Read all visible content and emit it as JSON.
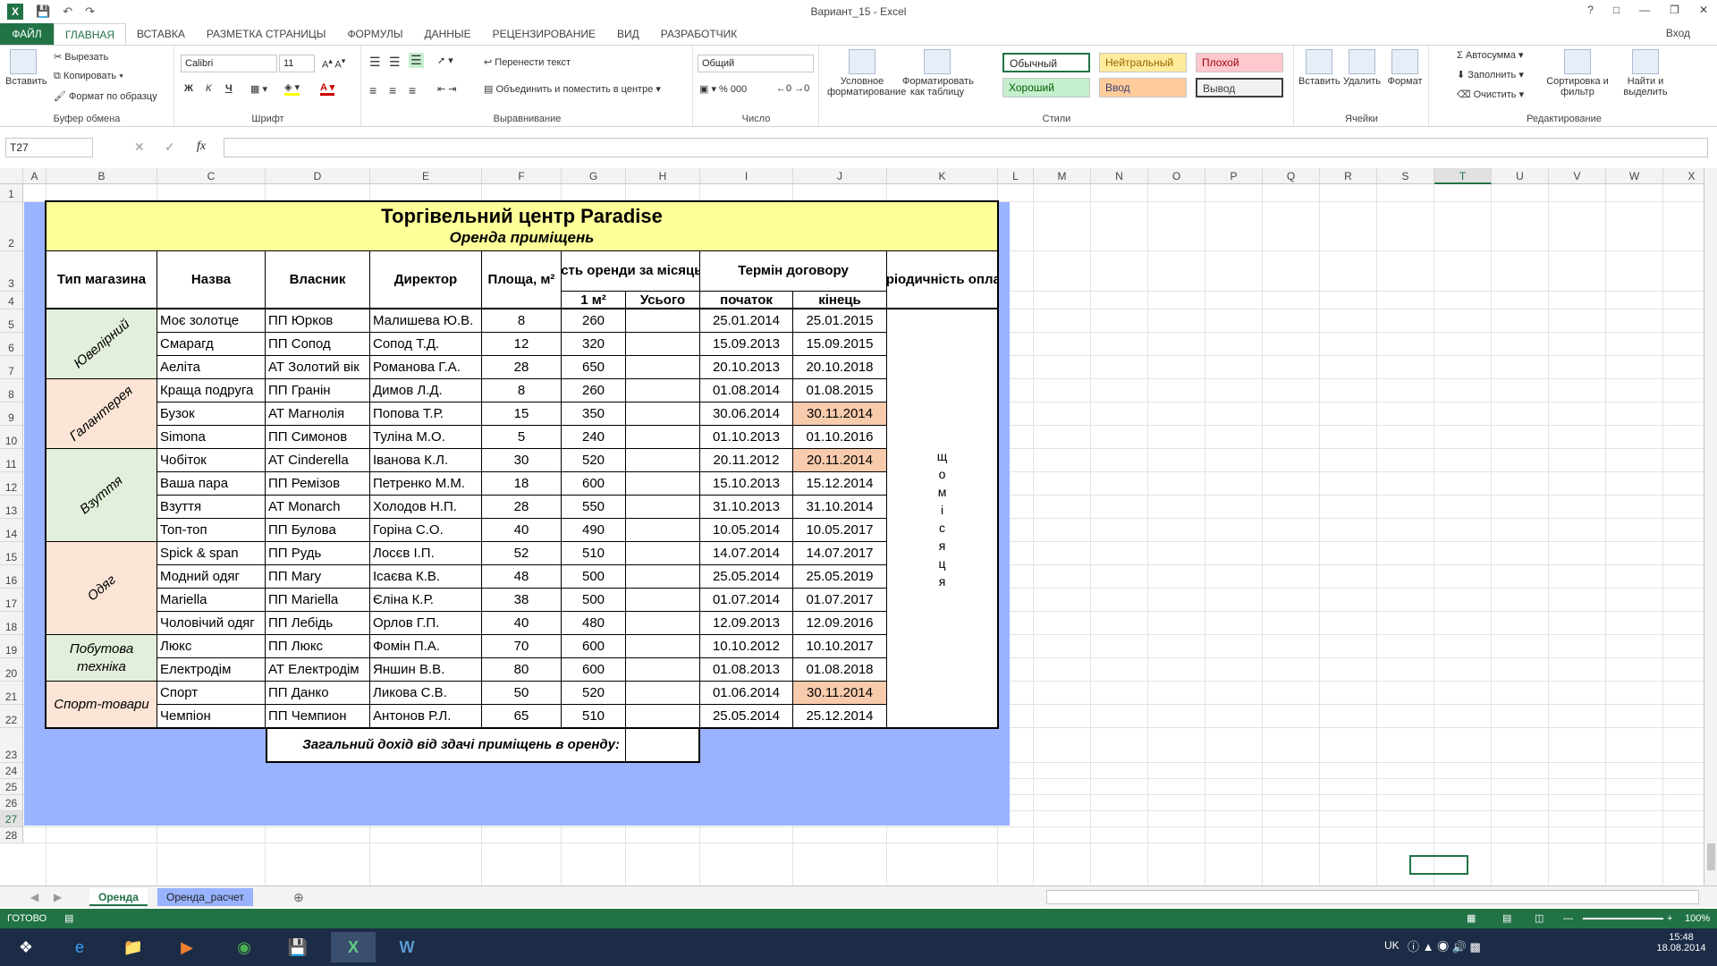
{
  "window": {
    "title": "Вариант_15 - Excel",
    "login": "Вход",
    "help": "?"
  },
  "tabs": [
    "ФАЙЛ",
    "ГЛАВНАЯ",
    "ВСТАВКА",
    "РАЗМЕТКА СТРАНИЦЫ",
    "ФОРМУЛЫ",
    "ДАННЫЕ",
    "РЕЦЕНЗИРОВАНИЕ",
    "ВИД",
    "РАЗРАБОТЧИК"
  ],
  "ribbon": {
    "clipboard": {
      "paste": "Вставить",
      "cut": "Вырезать",
      "copy": "Копировать",
      "format_painter": "Формат по образцу",
      "name": "Буфер обмена"
    },
    "font": {
      "family": "Calibri",
      "size": "11",
      "bold": "Ж",
      "italic": "К",
      "underline": "Ч",
      "name": "Шрифт"
    },
    "alignment": {
      "wrap": "Перенести текст",
      "merge": "Объединить и поместить в центре",
      "name": "Выравнивание"
    },
    "number": {
      "format": "Общий",
      "name": "Число"
    },
    "styles": {
      "conditional": "Условное форматирование",
      "as_table": "Форматировать как таблицу",
      "normal": "Обычный",
      "neutral": "Нейтральный",
      "bad": "Плохой",
      "good": "Хороший",
      "input": "Ввод",
      "output": "Вывод",
      "name": "Стили"
    },
    "cells": {
      "insert": "Вставить",
      "delete": "Удалить",
      "format": "Формат",
      "name": "Ячейки"
    },
    "editing": {
      "autosum": "Автосумма",
      "fill": "Заполнить",
      "clear": "Очистить",
      "sort": "Сортировка и фильтр",
      "find": "Найти и выделить",
      "name": "Редактирование"
    }
  },
  "formula_bar": {
    "cell_ref": "T27",
    "fx": "fx",
    "content": ""
  },
  "columns": [
    "A",
    "B",
    "C",
    "D",
    "E",
    "F",
    "G",
    "H",
    "I",
    "J",
    "K",
    "L",
    "M",
    "N",
    "O",
    "P",
    "Q",
    "R",
    "S",
    "T",
    "U",
    "V",
    "W",
    "X"
  ],
  "rows": [
    "1",
    "2",
    "3",
    "4",
    "5",
    "6",
    "7",
    "8",
    "9",
    "10",
    "11",
    "12",
    "13",
    "14",
    "15",
    "16",
    "17",
    "18",
    "19",
    "20",
    "21",
    "22",
    "23",
    "24",
    "25",
    "26",
    "27",
    "28"
  ],
  "table": {
    "title": "Торгівельний центр Paradise",
    "subtitle": "Оренда приміщень",
    "headers": {
      "type": "Тип магазина",
      "name": "Назва",
      "owner": "Власник",
      "director": "Директор",
      "area": "Площа, м²",
      "cost": "Вартість оренди за місяць, грн.",
      "cost_per_m2": "1 м²",
      "cost_total": "Усього",
      "term": "Термін договору",
      "start": "початок",
      "end": "кінець",
      "period": "Періодичність оплати"
    },
    "types": [
      "Ювелірний",
      "Галантерея",
      "Взуття",
      "Одяг",
      "Побутова техніка",
      "Спорт-товари"
    ],
    "period_value": [
      "щ",
      "о",
      "м",
      "і",
      "с",
      "я",
      "ц",
      "я"
    ],
    "rows": [
      [
        "Моє золотце",
        "ПП Юрков",
        "Малишева Ю.В.",
        "8",
        "260",
        "",
        "25.01.2014",
        "25.01.2015"
      ],
      [
        "Смарагд",
        "ПП Сопод",
        "Сопод Т.Д.",
        "12",
        "320",
        "",
        "15.09.2013",
        "15.09.2015"
      ],
      [
        "Аеліта",
        "АТ Золотий вік",
        "Романова Г.А.",
        "28",
        "650",
        "",
        "20.10.2013",
        "20.10.2018"
      ],
      [
        "Краща подруга",
        "ПП Гранін",
        "Димов Л.Д.",
        "8",
        "260",
        "",
        "01.08.2014",
        "01.08.2015"
      ],
      [
        "Бузок",
        "АТ Магнолія",
        "Попова Т.Р.",
        "15",
        "350",
        "",
        "30.06.2014",
        "30.11.2014"
      ],
      [
        "Simona",
        "ПП Симонов",
        "Туліна М.О.",
        "5",
        "240",
        "",
        "01.10.2013",
        "01.10.2016"
      ],
      [
        "Чобіток",
        "АТ Cinderella",
        "Іванова К.Л.",
        "30",
        "520",
        "",
        "20.11.2012",
        "20.11.2014"
      ],
      [
        "Ваша пара",
        "ПП Ремізов",
        "Петренко М.М.",
        "18",
        "600",
        "",
        "15.10.2013",
        "15.12.2014"
      ],
      [
        "Взуття",
        "АТ Monarch",
        "Холодов Н.П.",
        "28",
        "550",
        "",
        "31.10.2013",
        "31.10.2014"
      ],
      [
        "Топ-топ",
        "ПП Булова",
        "Горіна С.О.",
        "40",
        "490",
        "",
        "10.05.2014",
        "10.05.2017"
      ],
      [
        "Spick & span",
        "ПП Рудь",
        "Лосєв І.П.",
        "52",
        "510",
        "",
        "14.07.2014",
        "14.07.2017"
      ],
      [
        "Модний одяг",
        "ПП Mary",
        "Ісаєва К.В.",
        "48",
        "500",
        "",
        "25.05.2014",
        "25.05.2019"
      ],
      [
        "Mariella",
        "ПП Mariella",
        "Єліна К.Р.",
        "38",
        "500",
        "",
        "01.07.2014",
        "01.07.2017"
      ],
      [
        "Чоловічий одяг",
        "ПП Лебідь",
        "Орлов Г.П.",
        "40",
        "480",
        "",
        "12.09.2013",
        "12.09.2016"
      ],
      [
        "Люкс",
        "ПП Люкс",
        "Фомін П.А.",
        "70",
        "600",
        "",
        "10.10.2012",
        "10.10.2017"
      ],
      [
        "Електродім",
        "АТ Електродім",
        "Яншин В.В.",
        "80",
        "600",
        "",
        "01.08.2013",
        "01.08.2018"
      ],
      [
        "Спорт",
        "ПП Данко",
        "Ликова С.В.",
        "50",
        "520",
        "",
        "01.06.2014",
        "30.11.2014"
      ],
      [
        "Чемпіон",
        "ПП Чемпион",
        "Антонов Р.Л.",
        "65",
        "510",
        "",
        "25.05.2014",
        "25.12.2014"
      ]
    ],
    "highlighted_end_rows": [
      4,
      6,
      16
    ],
    "total_label": "Загальний дохід від здачі приміщень в оренду:"
  },
  "sheets": [
    "Оренда",
    "Оренда_расчет"
  ],
  "status": {
    "ready": "ГОТОВО",
    "zoom": "100%"
  },
  "taskbar": {
    "lang": "UK",
    "time": "15:48",
    "date": "18.08.2014"
  },
  "colors": {
    "excel_green": "#217346",
    "table_bg": "#99b3ff",
    "title_bg": "#ffff99",
    "highlight": "#f8cbad"
  }
}
